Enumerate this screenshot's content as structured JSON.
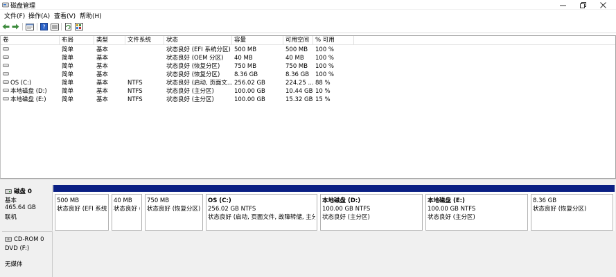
{
  "window": {
    "title": "磁盘管理"
  },
  "menu": {
    "items": [
      "文件(F)",
      "操作(A)",
      "查看(V)",
      "帮助(H)"
    ]
  },
  "toolbar": {
    "buttons": [
      "back-arrow-icon",
      "forward-arrow-icon",
      "properties-icon",
      "help-icon",
      "list-view-icon",
      "refresh-icon",
      "rescan-icon"
    ]
  },
  "columns": [
    "卷",
    "布局",
    "类型",
    "文件系统",
    "状态",
    "容量",
    "可用空间",
    "% 可用"
  ],
  "volumes": [
    {
      "name": "",
      "layout": "简单",
      "type": "基本",
      "fs": "",
      "status": "状态良好 (EFI 系统分区)",
      "capacity": "500 MB",
      "free": "500 MB",
      "pct": "100 %"
    },
    {
      "name": "",
      "layout": "简单",
      "type": "基本",
      "fs": "",
      "status": "状态良好 (OEM 分区)",
      "capacity": "40 MB",
      "free": "40 MB",
      "pct": "100 %"
    },
    {
      "name": "",
      "layout": "简单",
      "type": "基本",
      "fs": "",
      "status": "状态良好 (恢复分区)",
      "capacity": "750 MB",
      "free": "750 MB",
      "pct": "100 %"
    },
    {
      "name": "",
      "layout": "简单",
      "type": "基本",
      "fs": "",
      "status": "状态良好 (恢复分区)",
      "capacity": "8.36 GB",
      "free": "8.36 GB",
      "pct": "100 %"
    },
    {
      "name": "OS (C:)",
      "layout": "简单",
      "type": "基本",
      "fs": "NTFS",
      "status": "状态良好 (启动, 页面文...",
      "capacity": "256.02 GB",
      "free": "224.25 ...",
      "pct": "88 %"
    },
    {
      "name": "本地磁盘 (D:)",
      "layout": "简单",
      "type": "基本",
      "fs": "NTFS",
      "status": "状态良好 (主分区)",
      "capacity": "100.00 GB",
      "free": "10.44 GB",
      "pct": "10 %"
    },
    {
      "name": "本地磁盘 (E:)",
      "layout": "简单",
      "type": "基本",
      "fs": "NTFS",
      "status": "状态良好 (主分区)",
      "capacity": "100.00 GB",
      "free": "15.32 GB",
      "pct": "15 %"
    }
  ],
  "disk0": {
    "name": "磁盘 0",
    "type": "基本",
    "size": "465.64 GB",
    "state": "联机",
    "partitions": [
      {
        "title": "",
        "line1": "500 MB",
        "line2": "状态良好 (EFI 系统分区)"
      },
      {
        "title": "",
        "line1": "40 MB",
        "line2": "状态良好 (OEM 分区)"
      },
      {
        "title": "",
        "line1": "750 MB",
        "line2": "状态良好 (恢复分区)"
      },
      {
        "title": "OS  (C:)",
        "line1": "256.02 GB NTFS",
        "line2": "状态良好 (启动, 页面文件, 故障转储, 主分区)"
      },
      {
        "title": "本地磁盘  (D:)",
        "line1": "100.00 GB NTFS",
        "line2": "状态良好 (主分区)"
      },
      {
        "title": "本地磁盘  (E:)",
        "line1": "100.00 GB NTFS",
        "line2": "状态良好 (主分区)"
      },
      {
        "title": "",
        "line1": "8.36 GB",
        "line2": "状态良好 (恢复分区)"
      }
    ]
  },
  "cdrom0": {
    "name": "CD-ROM 0",
    "drive": "DVD (F:)",
    "state": "无媒体"
  },
  "colors": {
    "partition_header": "#0a1f83",
    "panel_bg": "#f0f0f0"
  }
}
